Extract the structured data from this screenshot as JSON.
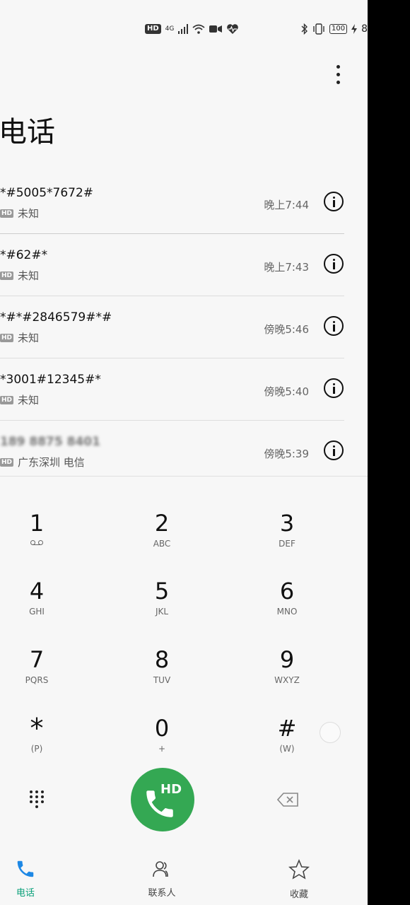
{
  "status_bar": {
    "hd": "HD",
    "network": "4G",
    "battery": "100",
    "clock_partial": "8"
  },
  "title": "电话",
  "calls": [
    {
      "number": "*#5005*7672#",
      "hd": "HD",
      "location": "未知",
      "time": "晚上7:44"
    },
    {
      "number": "*#62#*",
      "hd": "HD",
      "location": "未知",
      "time": "晚上7:43"
    },
    {
      "number": "*#*#2846579#*#",
      "hd": "HD",
      "location": "未知",
      "time": "傍晚5:46"
    },
    {
      "number": "*3001#12345#*",
      "hd": "HD",
      "location": "未知",
      "time": "傍晚5:40"
    },
    {
      "number": "189 8875 8401",
      "hd": "HD",
      "location": "广东深圳 电信",
      "time": "傍晚5:39"
    }
  ],
  "dialpad": [
    {
      "digit": "1",
      "letters": ""
    },
    {
      "digit": "2",
      "letters": "ABC"
    },
    {
      "digit": "3",
      "letters": "DEF"
    },
    {
      "digit": "4",
      "letters": "GHI"
    },
    {
      "digit": "5",
      "letters": "JKL"
    },
    {
      "digit": "6",
      "letters": "MNO"
    },
    {
      "digit": "7",
      "letters": "PQRS"
    },
    {
      "digit": "8",
      "letters": "TUV"
    },
    {
      "digit": "9",
      "letters": "WXYZ"
    },
    {
      "digit": "*",
      "letters": "(P)"
    },
    {
      "digit": "0",
      "letters": "+"
    },
    {
      "digit": "#",
      "letters": "(W)"
    }
  ],
  "call_button": {
    "hd": "HD",
    "color": "#34a853"
  },
  "nav": {
    "phone": "电话",
    "contacts": "联系人",
    "favorites": "收藏",
    "active_color": "#0aa07a"
  }
}
